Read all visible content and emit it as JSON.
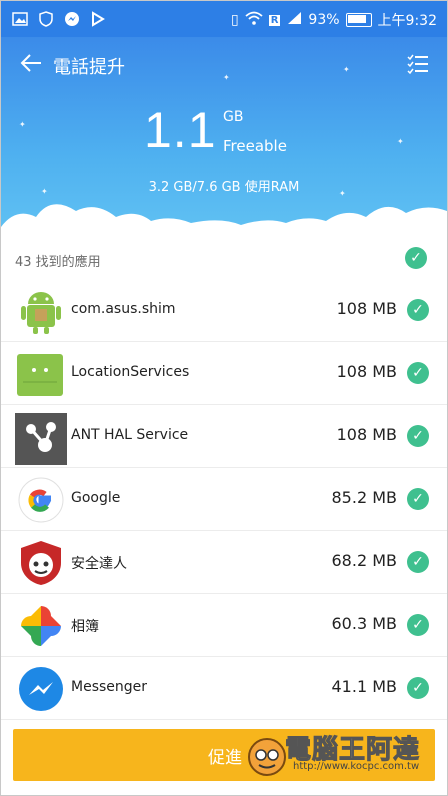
{
  "status_bar": {
    "battery": "93%",
    "time": "上午9:32",
    "sim_label": "R"
  },
  "header": {
    "title": "電話提升",
    "freeable_value": "1.1",
    "freeable_unit": "GB",
    "freeable_label": "Freeable",
    "ram_usage": "3.2 GB/7.6 GB 使用RAM"
  },
  "list": {
    "found_label": "43 找到的應用",
    "items": [
      {
        "name": "com.asus.shim",
        "size": "108 MB"
      },
      {
        "name": "LocationServices",
        "size": "108 MB"
      },
      {
        "name": "ANT HAL Service",
        "size": "108 MB"
      },
      {
        "name": "Google",
        "size": "85.2 MB"
      },
      {
        "name": "安全達人",
        "size": "68.2 MB"
      },
      {
        "name": "相簿",
        "size": "60.3 MB"
      },
      {
        "name": "Messenger",
        "size": "41.1 MB"
      }
    ]
  },
  "boost_button": {
    "label": "促進"
  },
  "watermark": {
    "text": "電腦王阿達",
    "url": "http://www.kocpc.com.tw"
  },
  "colors": {
    "header_top": "#3b8be9",
    "header_bottom": "#61c2f3",
    "check": "#3fc08f",
    "button": "#f7b51c"
  }
}
